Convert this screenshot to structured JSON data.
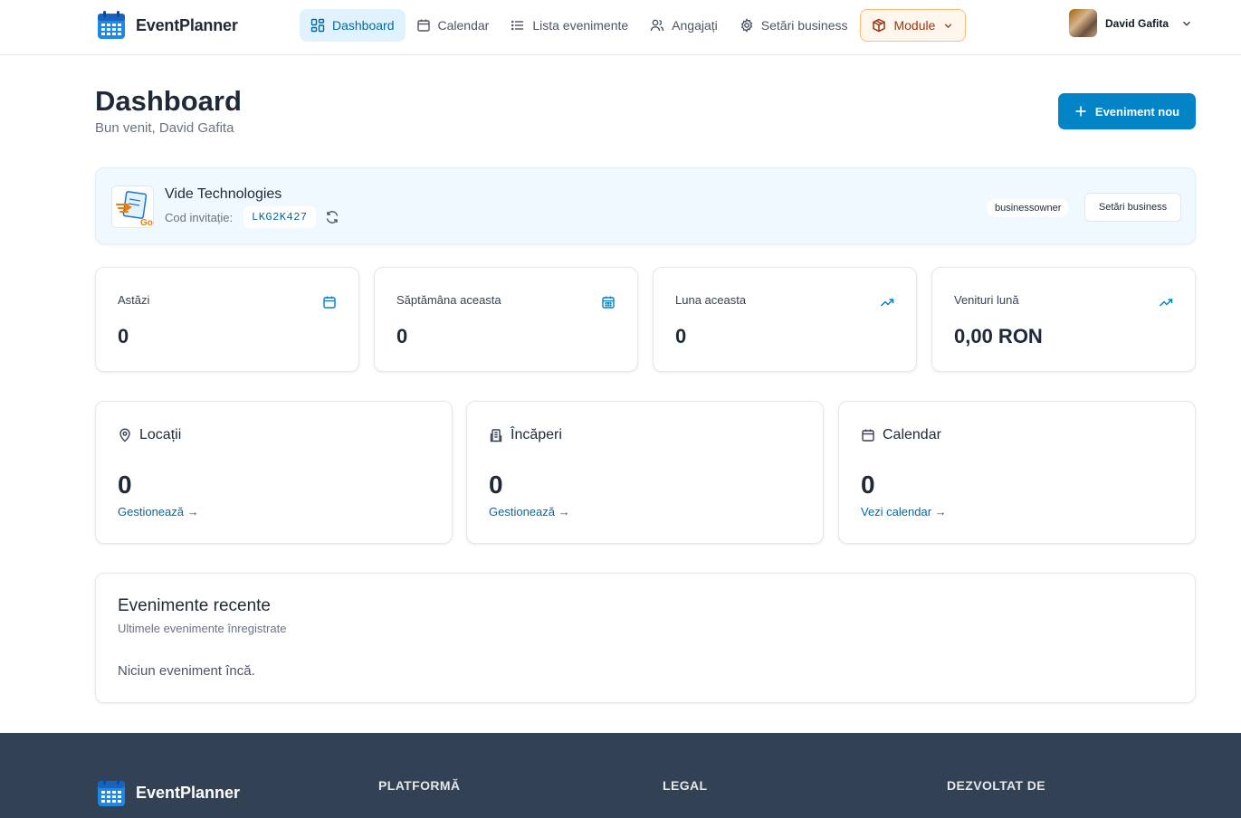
{
  "header": {
    "brand": "EventPlanner",
    "nav": [
      {
        "label": "Dashboard",
        "icon": "dashboard-icon",
        "active": true
      },
      {
        "label": "Calendar",
        "icon": "calendar-icon"
      },
      {
        "label": "Lista evenimente",
        "icon": "list-icon"
      },
      {
        "label": "Angajați",
        "icon": "users-icon"
      },
      {
        "label": "Setări business",
        "icon": "gear-icon"
      },
      {
        "label": "Module",
        "icon": "box-icon"
      }
    ],
    "user_name": "David Gafita"
  },
  "page": {
    "title": "Dashboard",
    "subtitle": "Bun venit, David Gafita",
    "new_event_label": "Eveniment nou"
  },
  "business": {
    "name": "Vide Technologies",
    "invite_label": "Cod invitație:",
    "invite_code": "LKG2K427",
    "role": "businessowner",
    "settings_label": "Setări business"
  },
  "stats": [
    {
      "label": "Astăzi",
      "value": "0",
      "icon": "calendar-icon"
    },
    {
      "label": "Săptămâna aceasta",
      "value": "0",
      "icon": "calendar-grid-icon"
    },
    {
      "label": "Luna aceasta",
      "value": "0",
      "icon": "trending-up-icon"
    },
    {
      "label": "Venituri lună",
      "value": "0,00 RON",
      "icon": "trending-up-icon"
    }
  ],
  "resources": [
    {
      "title": "Locații",
      "value": "0",
      "link": "Gestionează →",
      "icon": "map-pin-icon"
    },
    {
      "title": "Încăperi",
      "value": "0",
      "link": "Gestionează →",
      "icon": "building-icon"
    },
    {
      "title": "Calendar",
      "value": "0",
      "link": "Vezi calendar →",
      "icon": "calendar-icon"
    }
  ],
  "recent": {
    "title": "Evenimente recente",
    "subtitle": "Ultimele evenimente înregistrate",
    "empty": "Niciun eveniment încă."
  },
  "footer": {
    "brand": "EventPlanner",
    "columns": [
      "PLATFORMĂ",
      "LEGAL",
      "DEZVOLTAT DE"
    ]
  },
  "colors": {
    "accent": "#0284c7",
    "accent_dark": "#0369a1",
    "module_bg": "#fff7ed",
    "module_text": "#9a3412",
    "footer_bg": "#334155"
  }
}
